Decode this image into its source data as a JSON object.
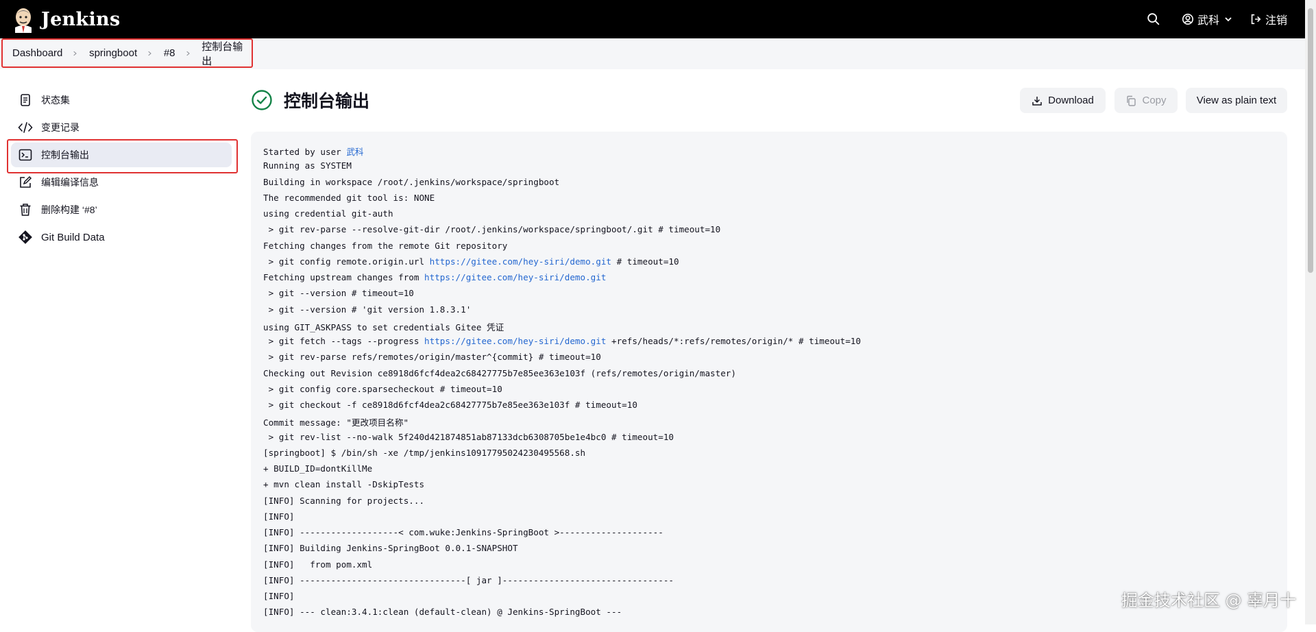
{
  "header": {
    "app_name": "Jenkins",
    "user_name": "武科",
    "logout_label": "注销"
  },
  "breadcrumb": [
    "Dashboard",
    "springboot",
    "#8",
    "控制台输出"
  ],
  "sidebar": {
    "items": [
      {
        "label": "状态集",
        "icon": "notepad-icon"
      },
      {
        "label": "变更记录",
        "icon": "code-icon"
      },
      {
        "label": "控制台输出",
        "icon": "terminal-icon",
        "active": true
      },
      {
        "label": "编辑编译信息",
        "icon": "edit-icon"
      },
      {
        "label": "删除构建 ‘#8’",
        "icon": "trash-icon"
      },
      {
        "label": "Git Build Data",
        "icon": "git-icon"
      }
    ]
  },
  "main": {
    "title": "控制台输出",
    "buttons": {
      "download": "Download",
      "copy": "Copy",
      "plain": "View as plain text"
    }
  },
  "console": {
    "lines": [
      {
        "pre": "Started by user ",
        "link": "武科",
        "post": ""
      },
      {
        "pre": "Running as SYSTEM"
      },
      {
        "pre": "Building in workspace /root/.jenkins/workspace/springboot"
      },
      {
        "pre": "The recommended git tool is: NONE"
      },
      {
        "pre": "using credential git-auth"
      },
      {
        "pre": " > git rev-parse --resolve-git-dir /root/.jenkins/workspace/springboot/.git # timeout=10"
      },
      {
        "pre": "Fetching changes from the remote Git repository"
      },
      {
        "pre": " > git config remote.origin.url ",
        "link": "https://gitee.com/hey-siri/demo.git",
        "post": " # timeout=10"
      },
      {
        "pre": "Fetching upstream changes from ",
        "link": "https://gitee.com/hey-siri/demo.git",
        "post": ""
      },
      {
        "pre": " > git --version # timeout=10"
      },
      {
        "pre": " > git --version # 'git version 1.8.3.1'"
      },
      {
        "pre": "using GIT_ASKPASS to set credentials Gitee 凭证"
      },
      {
        "pre": " > git fetch --tags --progress ",
        "link": "https://gitee.com/hey-siri/demo.git",
        "post": " +refs/heads/*:refs/remotes/origin/* # timeout=10"
      },
      {
        "pre": " > git rev-parse refs/remotes/origin/master^{commit} # timeout=10"
      },
      {
        "pre": "Checking out Revision ce8918d6fcf4dea2c68427775b7e85ee363e103f (refs/remotes/origin/master)"
      },
      {
        "pre": " > git config core.sparsecheckout # timeout=10"
      },
      {
        "pre": " > git checkout -f ce8918d6fcf4dea2c68427775b7e85ee363e103f # timeout=10"
      },
      {
        "pre": "Commit message: \"更改项目名称\""
      },
      {
        "pre": " > git rev-list --no-walk 5f240d421874851ab87133dcb6308705be1e4bc0 # timeout=10"
      },
      {
        "pre": "[springboot] $ /bin/sh -xe /tmp/jenkins10917795024230495568.sh"
      },
      {
        "pre": "+ BUILD_ID=dontKillMe"
      },
      {
        "pre": "+ mvn clean install -DskipTests"
      },
      {
        "pre": "[INFO] Scanning for projects..."
      },
      {
        "pre": "[INFO]"
      },
      {
        "pre": "[INFO] -------------------< com.wuke:Jenkins-SpringBoot >--------------------"
      },
      {
        "pre": "[INFO] Building Jenkins-SpringBoot 0.0.1-SNAPSHOT"
      },
      {
        "pre": "[INFO]   from pom.xml"
      },
      {
        "pre": "[INFO] --------------------------------[ jar ]---------------------------------"
      },
      {
        "pre": "[INFO]"
      },
      {
        "pre": "[INFO] --- clean:3.4.1:clean (default-clean) @ Jenkins-SpringBoot ---"
      }
    ]
  },
  "watermark": "掘金技术社区 @ 辜月十"
}
